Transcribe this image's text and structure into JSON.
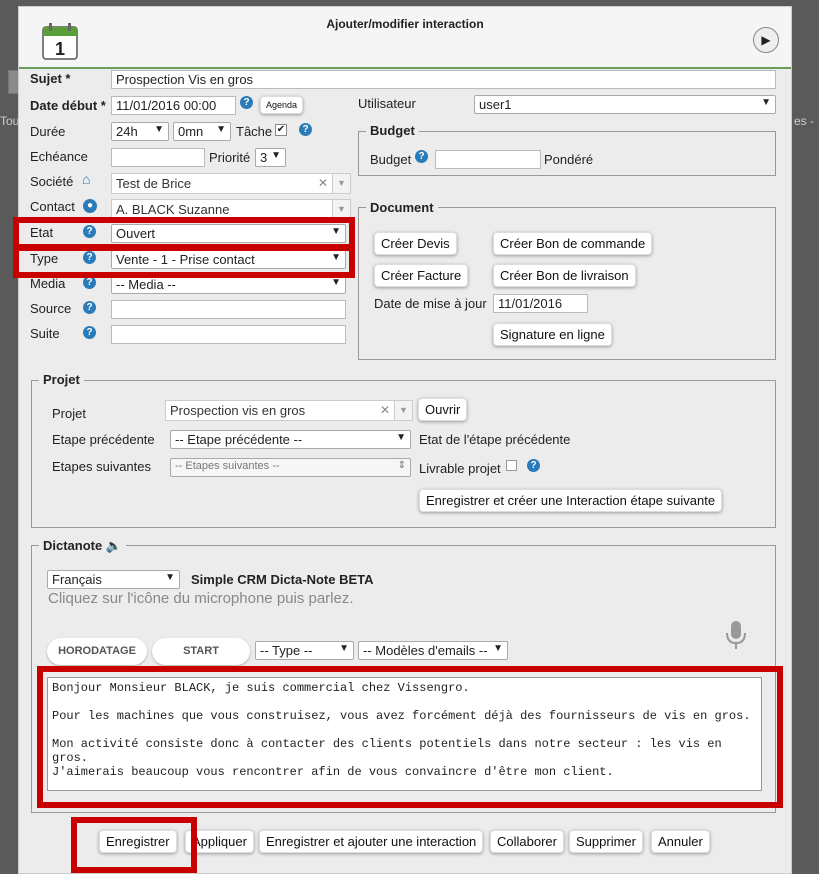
{
  "dialog": {
    "title": "Ajouter/modifier interaction"
  },
  "form": {
    "sujet": {
      "label": "Sujet *",
      "value": "Prospection Vis en gros"
    },
    "date_debut": {
      "label": "Date début *",
      "value": "11/01/2016 00:00",
      "agenda_button": "Agenda"
    },
    "utilisateur": {
      "label": "Utilisateur",
      "value": "user1"
    },
    "duree": {
      "label": "Durée",
      "hours": "24h",
      "minutes": "0mn",
      "tache_label": "Tâche"
    },
    "echeance": {
      "label": "Echéance",
      "value": ""
    },
    "priorite": {
      "label": "Priorité",
      "value": "3"
    },
    "societe": {
      "label": "Société",
      "value": "Test de Brice"
    },
    "contact": {
      "label": "Contact",
      "value": "A. BLACK Suzanne"
    },
    "etat": {
      "label": "Etat",
      "value": "Ouvert"
    },
    "type": {
      "label": "Type",
      "value": "Vente - 1 - Prise contact"
    },
    "media": {
      "label": "Media",
      "value": "-- Media --"
    },
    "source": {
      "label": "Source",
      "value": ""
    },
    "suite": {
      "label": "Suite",
      "value": ""
    }
  },
  "budget": {
    "legend": "Budget",
    "label": "Budget",
    "value": "",
    "pondere": "Pondéré"
  },
  "document": {
    "legend": "Document",
    "creer_devis": "Créer Devis",
    "creer_bon_commande": "Créer Bon de commande",
    "creer_facture": "Créer Facture",
    "creer_bon_livraison": "Créer Bon de livraison",
    "date_maj_label": "Date de mise à jour",
    "date_maj_value": "11/01/2016",
    "signature": "Signature en ligne"
  },
  "projet": {
    "legend": "Projet",
    "label": "Projet",
    "value": "Prospection vis en gros",
    "ouvrir": "Ouvrir",
    "etape_prec_label": "Etape précédente",
    "etape_prec_value": "-- Etape précédente --",
    "etat_etape_prec": "Etat de l'étape précédente",
    "etapes_suiv_label": "Etapes suivantes",
    "etapes_suiv_value": "-- Etapes suivantes --",
    "livrable": "Livrable projet",
    "enregistrer_creer": "Enregistrer et créer une Interaction étape suivante"
  },
  "dictanote": {
    "legend": "Dictanote",
    "lang": "Français",
    "title": "Simple CRM Dicta-Note BETA",
    "hint": "Cliquez sur l'icône du microphone puis parlez.",
    "horodatage": "HORODATAGE",
    "start": "START",
    "type_select": "-- Type --",
    "modeles_select": "-- Modèles d'emails --",
    "text": "Bonjour Monsieur BLACK, je suis commercial chez Vissengro.\n\nPour les machines que vous construisez, vous avez forcément déjà des fournisseurs de vis en gros.\n\nMon activité consiste donc à contacter des clients potentiels dans notre secteur : les vis en gros.\nJ'aimerais beaucoup vous rencontrer afin de vous convaincre d'être mon client."
  },
  "footer": {
    "enregistrer": "Enregistrer",
    "appliquer": "Appliquer",
    "enregistrer_ajouter": "Enregistrer et ajouter une interaction",
    "collaborer": "Collaborer",
    "supprimer": "Supprimer",
    "annuler": "Annuler"
  },
  "background": {
    "left_frag": "Tou",
    "right_frag": "es -"
  },
  "colors": {
    "accent_green": "#6a9f5a",
    "highlight_red": "#c80000",
    "help_blue": "#2b7bb9"
  }
}
